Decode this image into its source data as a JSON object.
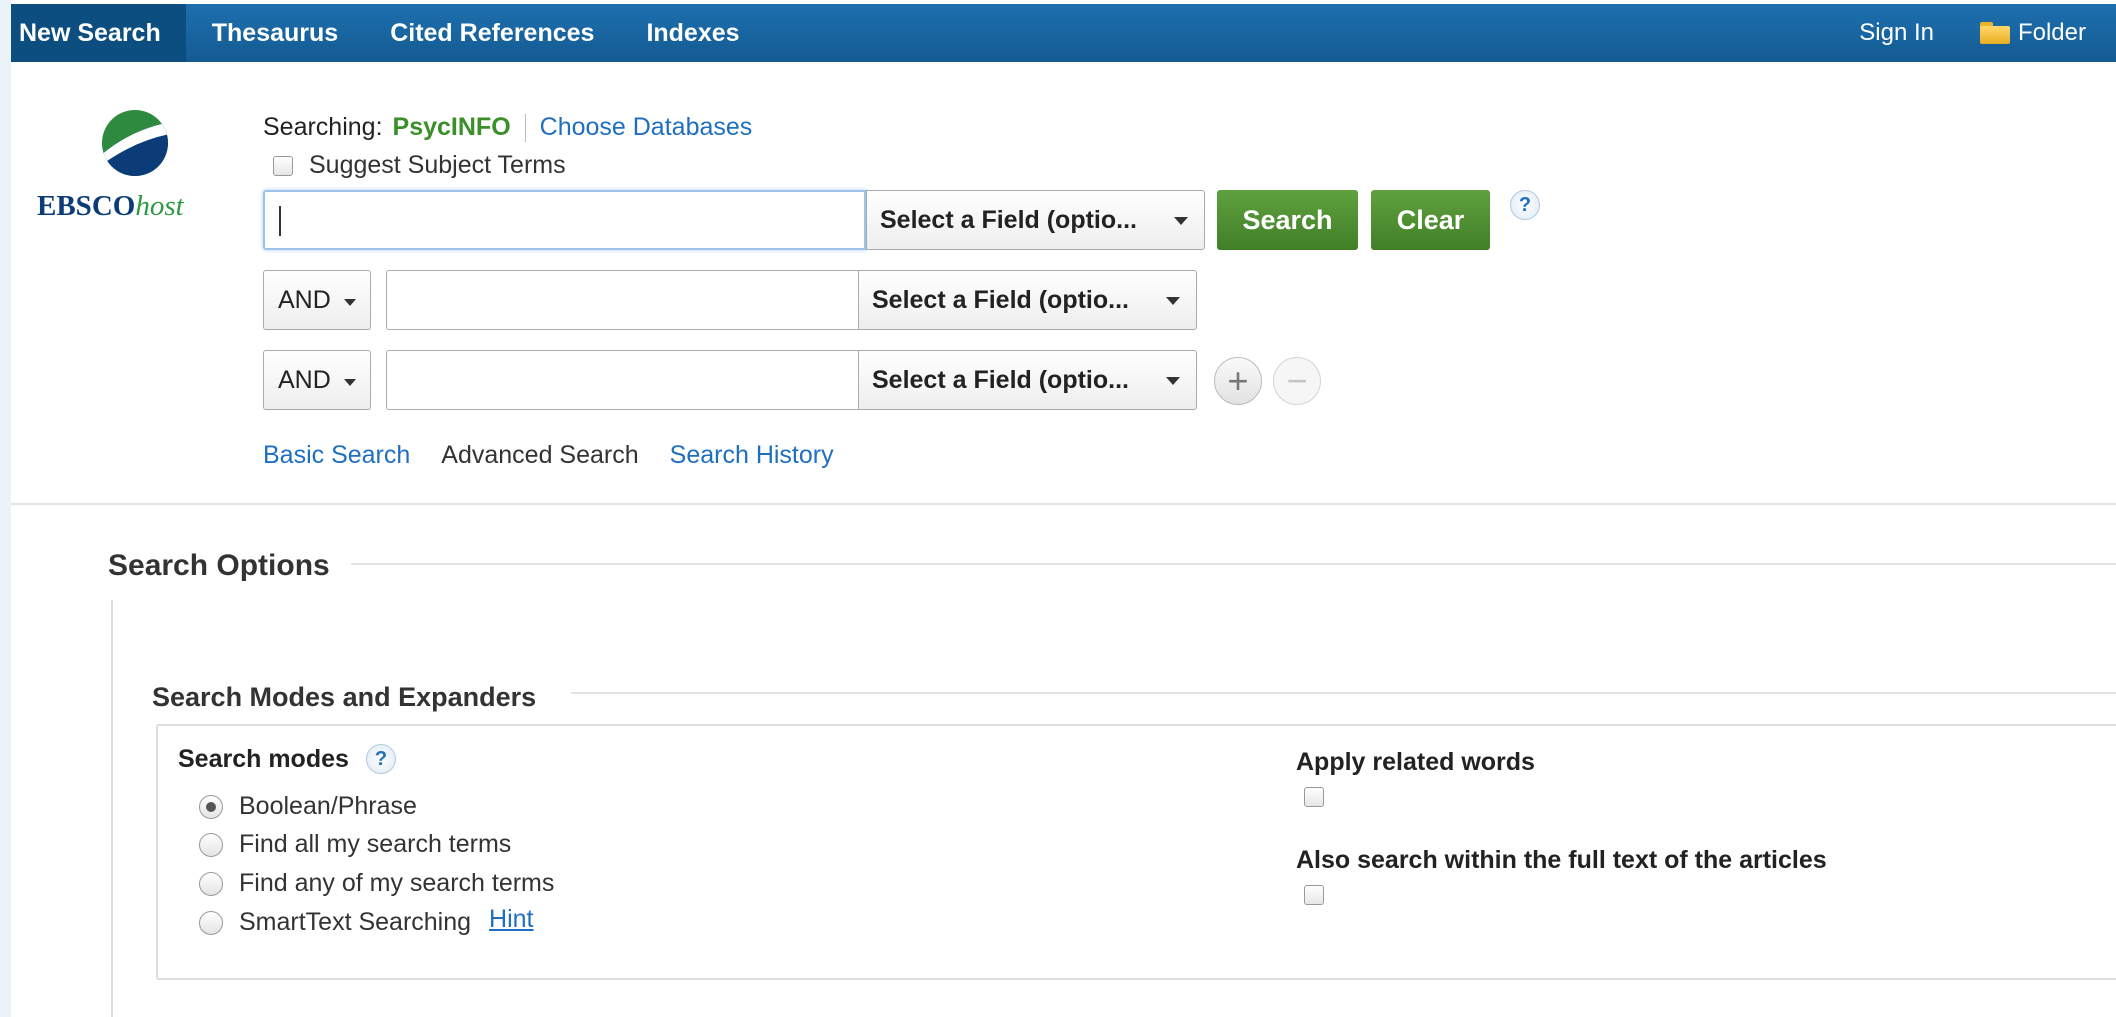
{
  "nav": {
    "items": [
      {
        "label": "New Search"
      },
      {
        "label": "Thesaurus"
      },
      {
        "label": "Cited References"
      },
      {
        "label": "Indexes"
      }
    ],
    "sign_in": "Sign In",
    "folder": "Folder"
  },
  "logo": {
    "brand": "EBSCO",
    "suffix": "host"
  },
  "search": {
    "searching_label": "Searching:",
    "database": "PsycINFO",
    "choose_databases": "Choose Databases",
    "suggest_subject_terms": "Suggest Subject Terms",
    "field_placeholder": "Select a Field (optio...",
    "operator": "AND",
    "search_button": "Search",
    "clear_button": "Clear",
    "help": "?"
  },
  "modes": {
    "basic": "Basic Search",
    "advanced": "Advanced Search",
    "history": "Search History"
  },
  "options": {
    "title": "Search Options",
    "modes_expanders_title": "Search Modes and Expanders",
    "search_modes_label": "Search modes",
    "radios": [
      {
        "label": "Boolean/Phrase",
        "checked": true
      },
      {
        "label": "Find all my search terms",
        "checked": false
      },
      {
        "label": "Find any of my search terms",
        "checked": false
      },
      {
        "label": "SmartText Searching",
        "checked": false
      }
    ],
    "hint": "Hint",
    "apply_related_words": "Apply related words",
    "full_text": "Also search within the full text of the articles"
  },
  "colors": {
    "nav_blue": "#1d6fae",
    "green_button": "#4f8f32",
    "link_blue": "#1f6fc0",
    "database_green": "#3c8f28"
  }
}
